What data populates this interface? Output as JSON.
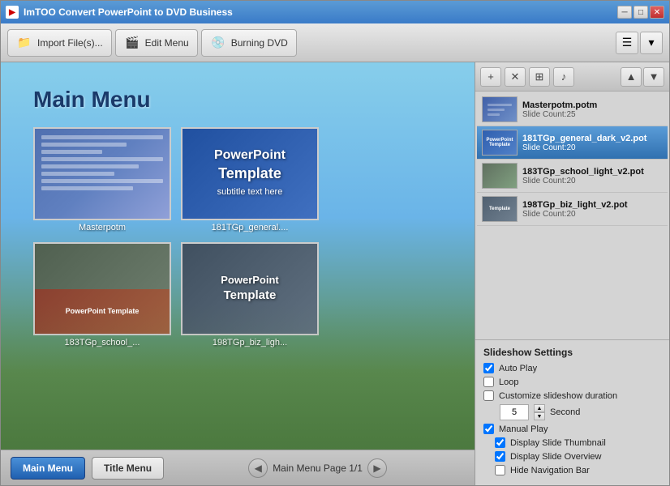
{
  "window": {
    "title": "ImTOO Convert PowerPoint to DVD Business",
    "icon": "DVD"
  },
  "toolbar": {
    "import_label": "Import File(s)...",
    "edit_menu_label": "Edit Menu",
    "burning_dvd_label": "Burning DVD"
  },
  "preview": {
    "title": "Main Menu",
    "slides": [
      {
        "name": "Masterpotm",
        "type": "1"
      },
      {
        "name": "181TGp_general....",
        "type": "2"
      },
      {
        "name": "183TGp_school_...",
        "type": "3"
      },
      {
        "name": "198TGp_biz_ligh...",
        "type": "4"
      }
    ]
  },
  "bottom_nav": {
    "btn1_label": "Main Menu",
    "btn2_label": "Title Menu",
    "page_info": "Main Menu Page 1/1"
  },
  "file_list": {
    "items": [
      {
        "name": "Masterpotm.potm",
        "meta": "Slide Count:25",
        "selected": false
      },
      {
        "name": "181TGp_general_dark_v2.pot",
        "meta": "Slide Count:20",
        "selected": true
      },
      {
        "name": "183TGp_school_light_v2.pot",
        "meta": "Slide Count:20",
        "selected": false
      },
      {
        "name": "198TGp_biz_light_v2.pot",
        "meta": "Slide Count:20",
        "selected": false
      }
    ]
  },
  "settings": {
    "title": "Slideshow Settings",
    "auto_play": {
      "label": "Auto Play",
      "checked": true
    },
    "loop": {
      "label": "Loop",
      "checked": false
    },
    "customize_duration": {
      "label": "Customize slideshow duration",
      "checked": false
    },
    "duration_value": "5",
    "duration_unit": "Second",
    "manual_play": {
      "label": "Manual Play",
      "checked": true
    },
    "display_thumbnail": {
      "label": "Display Slide Thumbnail",
      "checked": true
    },
    "display_overview": {
      "label": "Display Slide Overview",
      "checked": true
    },
    "hide_navigation": {
      "label": "Hide Navigation Bar",
      "checked": false
    }
  }
}
